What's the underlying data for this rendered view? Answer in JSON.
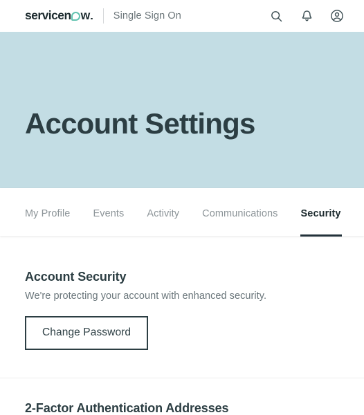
{
  "header": {
    "logo": {
      "part_a": "servicen",
      "loop_icon": "servicenow-o-loop-icon",
      "part_b": "w",
      "accent_color": "#62c3b0"
    },
    "app_name": "Single Sign On",
    "icons": [
      {
        "name": "search-icon",
        "label": "Search"
      },
      {
        "name": "bell-icon",
        "label": "Notifications"
      },
      {
        "name": "account-circle-icon",
        "label": "Account"
      }
    ]
  },
  "hero": {
    "title": "Account Settings",
    "background_color": "#c3dde4",
    "title_color": "#2c3e43"
  },
  "tabs": [
    {
      "label": "My Profile",
      "active": false
    },
    {
      "label": "Events",
      "active": false
    },
    {
      "label": "Activity",
      "active": false
    },
    {
      "label": "Communications",
      "active": false
    },
    {
      "label": "Security",
      "active": true
    }
  ],
  "content": {
    "account_security": {
      "title": "Account Security",
      "subtitle": "We're protecting your account with enhanced security.",
      "button_label": "Change Password"
    },
    "two_factor": {
      "title": "2-Factor Authentication Addresses"
    }
  }
}
